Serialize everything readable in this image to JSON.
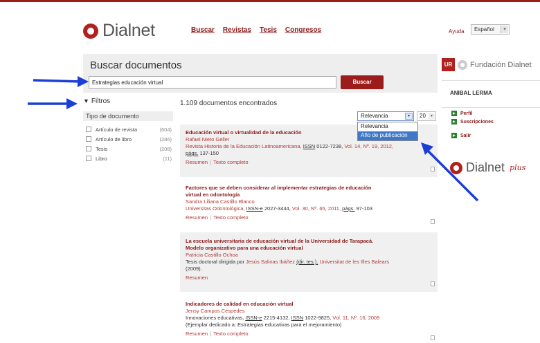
{
  "brand": {
    "logo_text": "Dialnet"
  },
  "nav": {
    "items": [
      {
        "label": "Buscar"
      },
      {
        "label": "Revistas"
      },
      {
        "label": "Tesis"
      },
      {
        "label": "Congresos"
      }
    ],
    "help": "Ayuda",
    "language": "Español"
  },
  "search": {
    "title": "Buscar documentos",
    "query": "Estrategias educación virtual",
    "button": "Buscar"
  },
  "filters": {
    "title": "Filtros",
    "group_title": "Tipo de documento",
    "items": [
      {
        "label": "Artículo de revista",
        "count": "(604)"
      },
      {
        "label": "Artículo de libro",
        "count": "(286)"
      },
      {
        "label": "Tesis",
        "count": "(208)"
      },
      {
        "label": "Libro",
        "count": "(11)"
      }
    ]
  },
  "results": {
    "count_text": "1.109 documentos encontrados",
    "sort": {
      "selected": "Relevancia",
      "options": [
        {
          "label": "Relevancia"
        },
        {
          "label": "Año de publicación"
        }
      ]
    },
    "per_page": "20",
    "items": [
      {
        "title": "Educación virtual o virtualidad de la educación",
        "author": "Rafael Nieto Geller",
        "source": "Revista Historia de la Educación Latinoamericana,",
        "issn_label": "ISSN",
        "issn": "0122-7238,",
        "volume": "Vol. 14, Nº. 19, 2012,",
        "pages_label": "págs.",
        "pages": "137-150",
        "action_1": "Resumen",
        "action_2": "Texto completo"
      },
      {
        "title_line_1": "Factores que se deben considerar al implementar estrategias de educación",
        "title_line_2": "virtual en odontología",
        "author": "Sandra Liliana Castillo Blanco",
        "source": "Universitas Odontológica,",
        "issn_label": "ISSN-e",
        "issn": "2027-3444,",
        "volume": "Vol. 30, Nº. 65, 2011,",
        "pages_label": "págs.",
        "pages": "97-103",
        "action_1": "Resumen",
        "action_2": "Texto completo"
      },
      {
        "title_line_1": "La escuela universitaria de educación virtual de la Universidad de Tarapacá.",
        "title_line_2": "Modelo organizativo para una educación virtual",
        "author": "Patricia Castillo Ochoa",
        "thesis_prefix": "Tesis doctoral dirigida por",
        "advisor": "Jesús Salinas Ibáñez",
        "advisor_role": "(dir. tes.).",
        "university": "Universitat de les Illes Balears",
        "year": "(2009).",
        "action_1": "Resumen"
      },
      {
        "title": "Indicadores de calidad en educación virtual",
        "author": "Jensy Campos Céspedes",
        "source": "Innovaciones educativas,",
        "issn_e_label": "ISSN-e",
        "issn_e": "2215-4132,",
        "issn_label": "ISSN",
        "issn": "1022-9825,",
        "volume": "Vol. 11, Nº. 16, 2009",
        "note": "(Ejemplar dedicado a: Estrategias educativas para el mejoramiento)",
        "action_1": "Resumen",
        "action_2": "Texto completo"
      }
    ]
  },
  "sidebar": {
    "foundation_badge": "UR",
    "foundation_text": "Fundación Dialnet",
    "user_name": "ANIBAL LERMA",
    "menu": [
      {
        "label": "Perfil"
      },
      {
        "label": "Suscripciones"
      },
      {
        "label": "Salir"
      }
    ],
    "plus_text": "Dialnet",
    "plus_script": "plus"
  },
  "colors": {
    "brand_red": "#9c1b1b",
    "link_red": "#b23a3a",
    "highlight_blue": "#3f78c6",
    "annotation_arrow": "#1a3fd6"
  },
  "icons": {
    "filter": "funnel-icon",
    "document": "document-icon",
    "dropdown": "chevron-down-icon",
    "menu_bullet": "green-arrow-icon"
  }
}
